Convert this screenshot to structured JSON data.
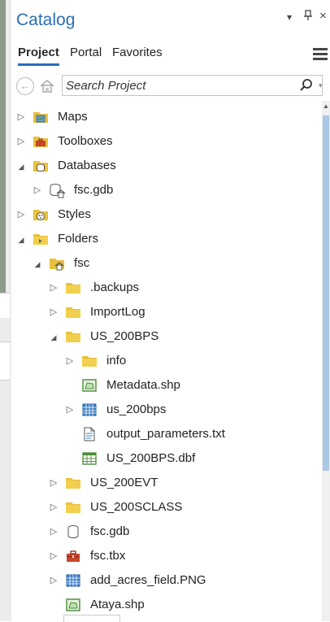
{
  "pane": {
    "title": "Catalog",
    "controls": {
      "dropdown": "▾",
      "pin": "ᵗ",
      "close": "×"
    }
  },
  "tabs": [
    {
      "label": "Project",
      "active": true
    },
    {
      "label": "Portal",
      "active": false
    },
    {
      "label": "Favorites",
      "active": false
    }
  ],
  "search": {
    "placeholder": "Search Project"
  },
  "tree": [
    {
      "label": "Maps",
      "icon": "maps-folder-icon",
      "arrow": "collapsed",
      "level": 0
    },
    {
      "label": "Toolboxes",
      "icon": "toolboxes-folder-icon",
      "arrow": "collapsed",
      "level": 0
    },
    {
      "label": "Databases",
      "icon": "databases-folder-icon",
      "arrow": "expanded",
      "level": 0
    },
    {
      "label": "fsc.gdb",
      "icon": "geodatabase-home-icon",
      "arrow": "collapsed",
      "level": 1
    },
    {
      "label": "Styles",
      "icon": "styles-folder-icon",
      "arrow": "collapsed",
      "level": 0
    },
    {
      "label": "Folders",
      "icon": "folders-folder-icon",
      "arrow": "expanded",
      "level": 0
    },
    {
      "label": "fsc",
      "icon": "home-folder-icon",
      "arrow": "expanded",
      "level": 1
    },
    {
      "label": ".backups",
      "icon": "folder-icon",
      "arrow": "collapsed",
      "level": 2
    },
    {
      "label": "ImportLog",
      "icon": "folder-icon",
      "arrow": "collapsed",
      "level": 2
    },
    {
      "label": "US_200BPS",
      "icon": "folder-icon",
      "arrow": "expanded",
      "level": 2
    },
    {
      "label": "info",
      "icon": "folder-icon",
      "arrow": "collapsed",
      "level": 3
    },
    {
      "label": "Metadata.shp",
      "icon": "polygon-shapefile-icon",
      "arrow": "none",
      "level": 3
    },
    {
      "label": "us_200bps",
      "icon": "raster-icon",
      "arrow": "collapsed",
      "level": 3
    },
    {
      "label": "output_parameters.txt",
      "icon": "text-file-icon",
      "arrow": "none",
      "level": 3
    },
    {
      "label": "US_200BPS.dbf",
      "icon": "table-icon",
      "arrow": "none",
      "level": 3
    },
    {
      "label": "US_200EVT",
      "icon": "folder-icon",
      "arrow": "collapsed",
      "level": 2
    },
    {
      "label": "US_200SCLASS",
      "icon": "folder-icon",
      "arrow": "collapsed",
      "level": 2
    },
    {
      "label": "fsc.gdb",
      "icon": "geodatabase-icon",
      "arrow": "collapsed",
      "level": 2
    },
    {
      "label": "fsc.tbx",
      "icon": "toolbox-icon",
      "arrow": "collapsed",
      "level": 2
    },
    {
      "label": "add_acres_field.PNG",
      "icon": "raster-icon",
      "arrow": "collapsed",
      "level": 2
    },
    {
      "label": "Ataya.shp",
      "icon": "polygon-shapefile-icon",
      "arrow": "none",
      "level": 2
    }
  ],
  "colors": {
    "accent": "#2a6fb8",
    "folder": "#e8c13d",
    "scroll_thumb": "#aac8e6"
  }
}
